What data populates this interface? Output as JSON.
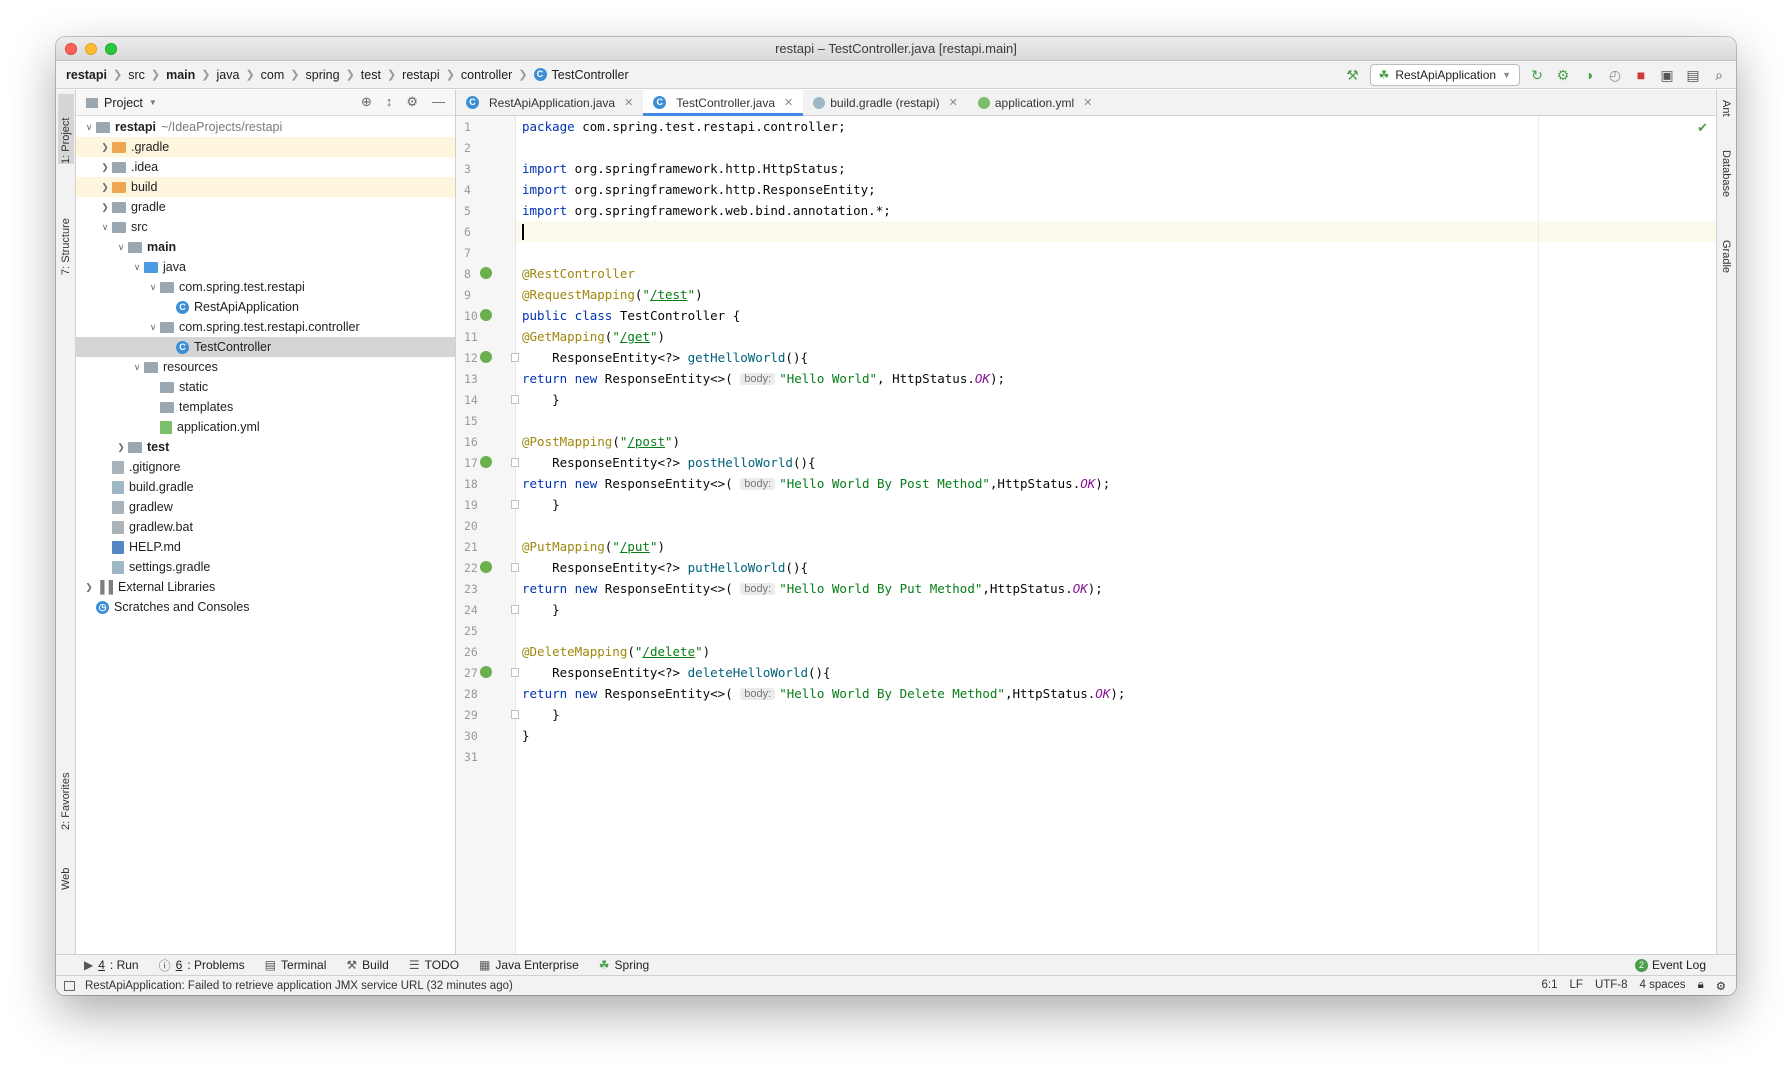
{
  "window": {
    "title": "restapi – TestController.java [restapi.main]"
  },
  "breadcrumbs": [
    "restapi",
    "src",
    "main",
    "java",
    "com",
    "spring",
    "test",
    "restapi",
    "controller",
    "TestController"
  ],
  "toolbar": {
    "run_config": "RestApiApplication"
  },
  "left_strip": {
    "project": "1: Project",
    "structure": "7: Structure",
    "favorites": "2: Favorites",
    "web": "Web"
  },
  "right_strip": {
    "ant": "Ant",
    "database": "Database",
    "gradle": "Gradle"
  },
  "project_panel": {
    "title": "Project"
  },
  "tree": [
    {
      "label": "restapi",
      "extra": "~/IdeaProjects/restapi",
      "level": 0,
      "arrow": "open",
      "icon": "module",
      "bold": true
    },
    {
      "label": ".gradle",
      "level": 1,
      "arrow": "closed",
      "icon": "folder-orange",
      "hl": true
    },
    {
      "label": ".idea",
      "level": 1,
      "arrow": "closed",
      "icon": "folder"
    },
    {
      "label": "build",
      "level": 1,
      "arrow": "closed",
      "icon": "folder-orange",
      "hl": true
    },
    {
      "label": "gradle",
      "level": 1,
      "arrow": "closed",
      "icon": "folder"
    },
    {
      "label": "src",
      "level": 1,
      "arrow": "open",
      "icon": "folder"
    },
    {
      "label": "main",
      "level": 2,
      "arrow": "open",
      "icon": "folder",
      "bold": true
    },
    {
      "label": "java",
      "level": 3,
      "arrow": "open",
      "icon": "folder-blue"
    },
    {
      "label": "com.spring.test.restapi",
      "level": 4,
      "arrow": "open",
      "icon": "package"
    },
    {
      "label": "RestApiApplication",
      "level": 5,
      "arrow": "",
      "icon": "class"
    },
    {
      "label": "com.spring.test.restapi.controller",
      "level": 4,
      "arrow": "open",
      "icon": "package"
    },
    {
      "label": "TestController",
      "level": 5,
      "arrow": "",
      "icon": "class",
      "sel": true
    },
    {
      "label": "resources",
      "level": 3,
      "arrow": "open",
      "icon": "folder"
    },
    {
      "label": "static",
      "level": 4,
      "arrow": "",
      "icon": "folder"
    },
    {
      "label": "templates",
      "level": 4,
      "arrow": "",
      "icon": "folder"
    },
    {
      "label": "application.yml",
      "level": 4,
      "arrow": "",
      "icon": "yml"
    },
    {
      "label": "test",
      "level": 2,
      "arrow": "closed",
      "icon": "folder",
      "bold": true
    },
    {
      "label": ".gitignore",
      "level": 1,
      "arrow": "",
      "icon": "file"
    },
    {
      "label": "build.gradle",
      "level": 1,
      "arrow": "",
      "icon": "gradle"
    },
    {
      "label": "gradlew",
      "level": 1,
      "arrow": "",
      "icon": "file"
    },
    {
      "label": "gradlew.bat",
      "level": 1,
      "arrow": "",
      "icon": "file"
    },
    {
      "label": "HELP.md",
      "level": 1,
      "arrow": "",
      "icon": "md"
    },
    {
      "label": "settings.gradle",
      "level": 1,
      "arrow": "",
      "icon": "gradle"
    },
    {
      "label": "External Libraries",
      "level": 0,
      "arrow": "closed",
      "icon": "lib"
    },
    {
      "label": "Scratches and Consoles",
      "level": 0,
      "arrow": "",
      "icon": "scratch"
    }
  ],
  "tabs": [
    {
      "label": "RestApiApplication.java",
      "icon": "class",
      "active": false
    },
    {
      "label": "TestController.java",
      "icon": "class",
      "active": true
    },
    {
      "label": "build.gradle (restapi)",
      "icon": "gradle",
      "active": false
    },
    {
      "label": "application.yml",
      "icon": "yml",
      "active": false
    }
  ],
  "code": [
    {
      "n": "1",
      "t": "<span class='kw'>package</span> com.spring.test.restapi.controller;"
    },
    {
      "n": "2",
      "t": ""
    },
    {
      "n": "3",
      "t": "<span class='kw'>import</span> org.springframework.http.HttpStatus;"
    },
    {
      "n": "4",
      "t": "<span class='kw'>import</span> org.springframework.http.ResponseEntity;"
    },
    {
      "n": "5",
      "t": "<span class='kw'>import</span> org.springframework.web.bind.annotation.*;"
    },
    {
      "n": "6",
      "t": "<span class='cursor'></span>",
      "caret": true
    },
    {
      "n": "7",
      "t": ""
    },
    {
      "n": "8",
      "t": "<span class='ann'>@RestController</span>",
      "icon": true
    },
    {
      "n": "9",
      "t": "<span class='ann'>@RequestMapping</span>(<span class='str'>\"</span><span class='url'>/test</span><span class='str'>\"</span>)"
    },
    {
      "n": "10",
      "t": "<span class='kw'>public class</span> TestController {",
      "icon": true
    },
    {
      "n": "11",
      "t": "    <span class='ann'>@GetMapping</span>(<span class='str'>\"</span><span class='url'>/get</span><span class='str'>\"</span>)"
    },
    {
      "n": "12",
      "t": "    ResponseEntity&lt;?&gt; <span class='fn'>getHelloWorld</span>(){",
      "icon": true,
      "fold": true
    },
    {
      "n": "13",
      "t": "        <span class='kw'>return new</span> ResponseEntity&lt;&gt;( <span class='hint'>body:</span><span class='str'>\"Hello World\"</span>, HttpStatus.<span class='ok'>OK</span>);"
    },
    {
      "n": "14",
      "t": "    }",
      "fold": true
    },
    {
      "n": "15",
      "t": ""
    },
    {
      "n": "16",
      "t": "    <span class='ann'>@PostMapping</span>(<span class='str'>\"</span><span class='url'>/post</span><span class='str'>\"</span>)"
    },
    {
      "n": "17",
      "t": "    ResponseEntity&lt;?&gt; <span class='fn'>postHelloWorld</span>(){",
      "icon": true,
      "fold": true
    },
    {
      "n": "18",
      "t": "        <span class='kw'>return new</span> ResponseEntity&lt;&gt;( <span class='hint'>body:</span><span class='str'>\"Hello World By Post Method\"</span>,HttpStatus.<span class='ok'>OK</span>);"
    },
    {
      "n": "19",
      "t": "    }",
      "fold": true
    },
    {
      "n": "20",
      "t": ""
    },
    {
      "n": "21",
      "t": "    <span class='ann'>@PutMapping</span>(<span class='str'>\"</span><span class='url'>/put</span><span class='str'>\"</span>)"
    },
    {
      "n": "22",
      "t": "    ResponseEntity&lt;?&gt; <span class='fn'>putHelloWorld</span>(){",
      "icon": true,
      "fold": true
    },
    {
      "n": "23",
      "t": "        <span class='kw'>return new</span> ResponseEntity&lt;&gt;( <span class='hint'>body:</span><span class='str'>\"Hello World By Put Method\"</span>,HttpStatus.<span class='ok'>OK</span>);"
    },
    {
      "n": "24",
      "t": "    }",
      "fold": true
    },
    {
      "n": "25",
      "t": ""
    },
    {
      "n": "26",
      "t": "    <span class='ann'>@DeleteMapping</span>(<span class='str'>\"</span><span class='url'>/delete</span><span class='str'>\"</span>)"
    },
    {
      "n": "27",
      "t": "    ResponseEntity&lt;?&gt; <span class='fn'>deleteHelloWorld</span>(){",
      "icon": true,
      "fold": true
    },
    {
      "n": "28",
      "t": "        <span class='kw'>return new</span> ResponseEntity&lt;&gt;( <span class='hint'>body:</span><span class='str'>\"Hello World By Delete Method\"</span>,HttpStatus.<span class='ok'>OK</span>);"
    },
    {
      "n": "29",
      "t": "    }",
      "fold": true
    },
    {
      "n": "30",
      "t": "}"
    },
    {
      "n": "31",
      "t": ""
    }
  ],
  "toolwindows": [
    {
      "key": "4",
      "label": ": Run",
      "icon": "run-icon"
    },
    {
      "key": "6",
      "label": ": Problems",
      "icon": "problems-icon"
    },
    {
      "key": "",
      "label": "Terminal",
      "icon": "terminal-icon"
    },
    {
      "key": "",
      "label": "Build",
      "icon": "build-icon"
    },
    {
      "key": "",
      "label": "TODO",
      "icon": "todo-icon"
    },
    {
      "key": "",
      "label": "Java Enterprise",
      "icon": "java-enterprise-icon"
    },
    {
      "key": "",
      "label": "Spring",
      "icon": "spring-icon"
    }
  ],
  "event_log": {
    "label": "Event Log",
    "count": "2"
  },
  "status": {
    "message": "RestApiApplication: Failed to retrieve application JMX service URL (32 minutes ago)",
    "position": "6:1",
    "line_sep": "LF",
    "encoding": "UTF-8",
    "indent": "4 spaces"
  }
}
